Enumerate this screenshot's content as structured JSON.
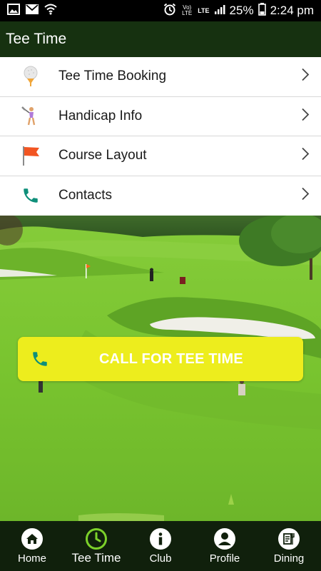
{
  "status_bar": {
    "left_icons": [
      "image-icon",
      "mail-icon",
      "wifi-icon"
    ],
    "right_icons": [
      "alarm-icon",
      "volte-icon",
      "lte-icon",
      "signal-icon"
    ],
    "volte_text": "Vo) LTE",
    "lte_text": "LTE",
    "battery": "25%",
    "time": "2:24 pm"
  },
  "app_bar": {
    "title": "Tee Time"
  },
  "menu": {
    "items": [
      {
        "label": "Tee Time Booking",
        "icon": "golf-ball-icon"
      },
      {
        "label": "Handicap Info",
        "icon": "golfer-icon"
      },
      {
        "label": "Course Layout",
        "icon": "flag-icon"
      },
      {
        "label": "Contacts",
        "icon": "phone-icon"
      }
    ]
  },
  "call_button": {
    "label": "CALL FOR TEE TIME",
    "icon": "phone-icon"
  },
  "bottom_nav": {
    "items": [
      {
        "label": "Home",
        "icon": "home-icon",
        "active": false
      },
      {
        "label": "Tee Time",
        "icon": "clock-icon",
        "active": true
      },
      {
        "label": "Club",
        "icon": "info-icon",
        "active": false
      },
      {
        "label": "Profile",
        "icon": "profile-icon",
        "active": false
      },
      {
        "label": "Dining",
        "icon": "dining-icon",
        "active": false
      }
    ]
  },
  "colors": {
    "status_bar": "#000000",
    "app_bar": "#163110",
    "call_button": "#eded1d",
    "call_icon": "#0f8f7a",
    "bottom_nav": "#10200c",
    "active_nav": "#7cd12a",
    "grass": "#79c42f"
  }
}
